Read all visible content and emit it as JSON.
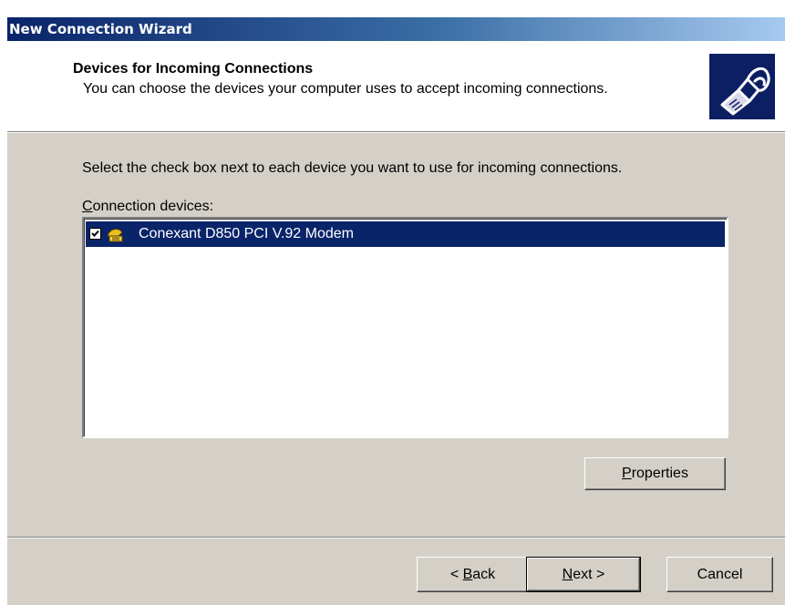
{
  "window": {
    "title": "New Connection Wizard"
  },
  "header": {
    "title": "Devices for Incoming Connections",
    "subtitle": "You can choose the devices your computer uses to accept incoming connections.",
    "icon": "network-cable-icon"
  },
  "body": {
    "instruction": "Select the check box next to each device you want to use for incoming connections.",
    "devices_label_mnemonic": "C",
    "devices_label_rest": "onnection devices:",
    "devices": [
      {
        "label": "Conexant D850 PCI V.92 Modem",
        "checked": true,
        "selected": true,
        "icon": "modem-icon"
      }
    ]
  },
  "buttons": {
    "properties_mnemonic": "P",
    "properties_rest": "roperties",
    "back_prefix": "< ",
    "back_mnemonic": "B",
    "back_rest": "ack",
    "next_mnemonic": "N",
    "next_rest": "ext >",
    "cancel": "Cancel"
  },
  "colors": {
    "title_gradient_start": "#0a246a",
    "title_gradient_end": "#a6caf0",
    "selection": "#0a246a",
    "dialog_face": "#d4d0c8"
  }
}
